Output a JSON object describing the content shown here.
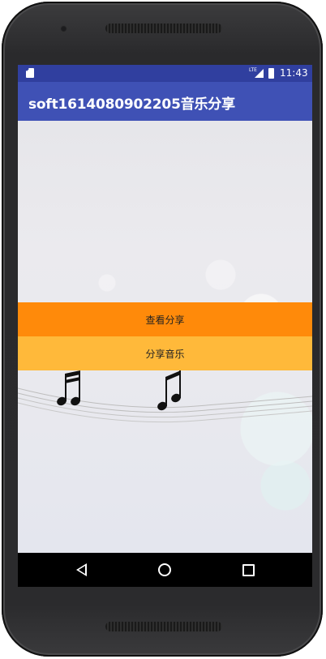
{
  "status_bar": {
    "time": "11:43",
    "network_label": "LTE",
    "icons": [
      "sim-card-icon",
      "signal-icon",
      "battery-icon"
    ]
  },
  "app_bar": {
    "title": "soft1614080902205音乐分享"
  },
  "buttons": {
    "view_share_label": "查看分享",
    "share_music_label": "分享音乐"
  },
  "nav_bar": {
    "icons": [
      "back-icon",
      "home-icon",
      "recent-apps-icon"
    ]
  },
  "colors": {
    "status_bar": "#303f9f",
    "app_bar": "#3f51b5",
    "view_button": "#ff8a0a",
    "share_button": "#ffb93a"
  }
}
